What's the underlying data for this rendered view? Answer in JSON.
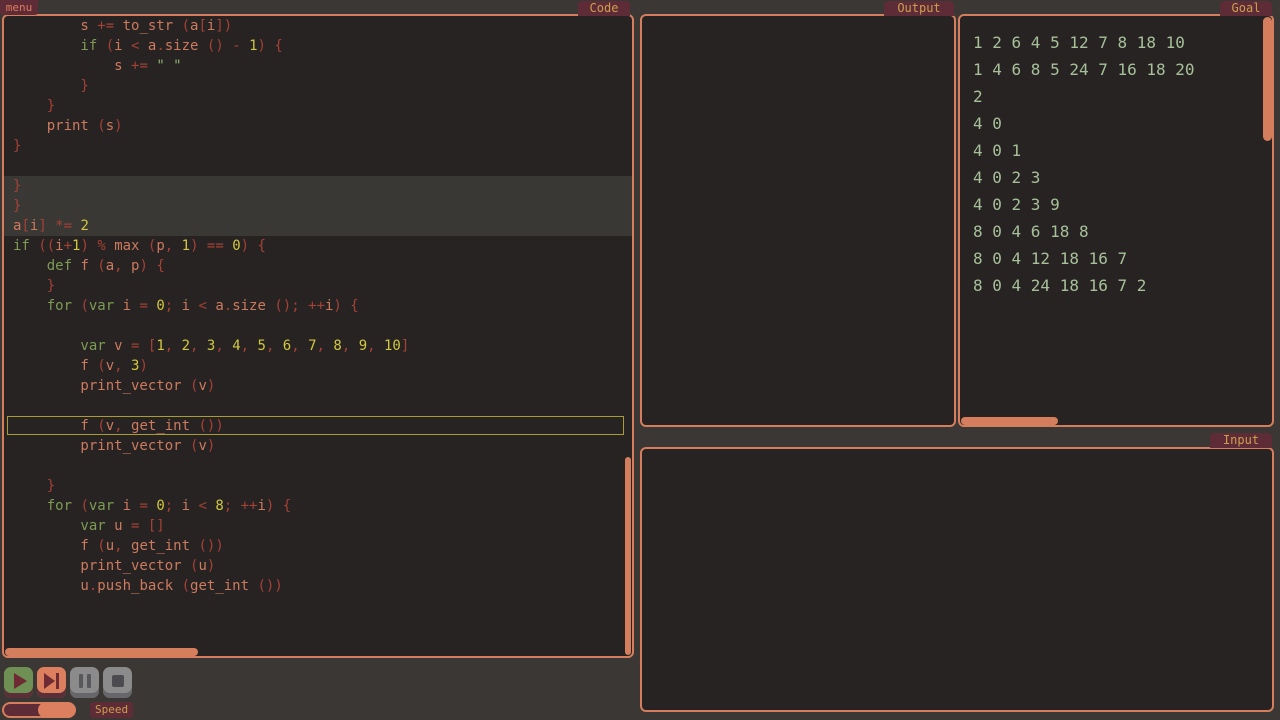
{
  "menu": {
    "label": "menu"
  },
  "tabs": {
    "code": "Code",
    "output": "Output",
    "goal": "Goal",
    "input": "Input"
  },
  "code": {
    "lines": [
      {
        "tk": [
          [
            "t",
            "        s "
          ],
          [
            "o",
            "+= "
          ],
          [
            "t",
            "to_str "
          ],
          [
            "o",
            "("
          ],
          [
            "t",
            "a"
          ],
          [
            "o",
            "["
          ],
          [
            "t",
            "i"
          ],
          [
            "o",
            "])"
          ]
        ]
      },
      {
        "tk": [
          [
            "k",
            "        if "
          ],
          [
            "o",
            "("
          ],
          [
            "t",
            "i "
          ],
          [
            "o",
            "< "
          ],
          [
            "t",
            "a"
          ],
          [
            "o",
            "."
          ],
          [
            "t",
            "size "
          ],
          [
            "o",
            "() - "
          ],
          [
            "n",
            "1"
          ],
          [
            "o",
            ") {"
          ]
        ]
      },
      {
        "tk": [
          [
            "t",
            "            s "
          ],
          [
            "o",
            "+= "
          ],
          [
            "s",
            "\" \""
          ]
        ]
      },
      {
        "tk": [
          [
            "o",
            "        }"
          ]
        ]
      },
      {
        "tk": [
          [
            "o",
            "    }"
          ]
        ]
      },
      {
        "tk": [
          [
            "t",
            "    print "
          ],
          [
            "o",
            "("
          ],
          [
            "t",
            "s"
          ],
          [
            "o",
            ")"
          ]
        ]
      },
      {
        "tk": [
          [
            "o",
            "}"
          ]
        ]
      },
      {
        "tk": []
      },
      {
        "hl": true,
        "tk": [
          [
            "o",
            "}"
          ]
        ]
      },
      {
        "hl": true,
        "tk": [
          [
            "o",
            "}"
          ]
        ]
      },
      {
        "hl": true,
        "tk": [
          [
            "t",
            "a"
          ],
          [
            "o",
            "["
          ],
          [
            "t",
            "i"
          ],
          [
            "o",
            "] *= "
          ],
          [
            "n",
            "2"
          ]
        ]
      },
      {
        "tk": [
          [
            "k",
            "if "
          ],
          [
            "o",
            "(("
          ],
          [
            "t",
            "i"
          ],
          [
            "o",
            "+"
          ],
          [
            "n",
            "1"
          ],
          [
            "o",
            ") % "
          ],
          [
            "t",
            "max "
          ],
          [
            "o",
            "("
          ],
          [
            "t",
            "p"
          ],
          [
            "o",
            ", "
          ],
          [
            "n",
            "1"
          ],
          [
            "o",
            ") == "
          ],
          [
            "n",
            "0"
          ],
          [
            "o",
            ") {"
          ]
        ]
      },
      {
        "tk": [
          [
            "k",
            "    def "
          ],
          [
            "t",
            "f "
          ],
          [
            "o",
            "("
          ],
          [
            "t",
            "a"
          ],
          [
            "o",
            ", "
          ],
          [
            "t",
            "p"
          ],
          [
            "o",
            ") {"
          ]
        ]
      },
      {
        "tk": [
          [
            "o",
            "    }"
          ]
        ]
      },
      {
        "tk": [
          [
            "k",
            "    for "
          ],
          [
            "o",
            "("
          ],
          [
            "k",
            "var "
          ],
          [
            "t",
            "i "
          ],
          [
            "o",
            "= "
          ],
          [
            "n",
            "0"
          ],
          [
            "o",
            "; "
          ],
          [
            "t",
            "i "
          ],
          [
            "o",
            "< "
          ],
          [
            "t",
            "a"
          ],
          [
            "o",
            "."
          ],
          [
            "t",
            "size "
          ],
          [
            "o",
            "(); ++"
          ],
          [
            "t",
            "i"
          ],
          [
            "o",
            ") {"
          ]
        ]
      },
      {
        "tk": []
      },
      {
        "tk": [
          [
            "k",
            "        var "
          ],
          [
            "t",
            "v "
          ],
          [
            "o",
            "= ["
          ],
          [
            "n",
            "1"
          ],
          [
            "o",
            ", "
          ],
          [
            "n",
            "2"
          ],
          [
            "o",
            ", "
          ],
          [
            "n",
            "3"
          ],
          [
            "o",
            ", "
          ],
          [
            "n",
            "4"
          ],
          [
            "o",
            ", "
          ],
          [
            "n",
            "5"
          ],
          [
            "o",
            ", "
          ],
          [
            "n",
            "6"
          ],
          [
            "o",
            ", "
          ],
          [
            "n",
            "7"
          ],
          [
            "o",
            ", "
          ],
          [
            "n",
            "8"
          ],
          [
            "o",
            ", "
          ],
          [
            "n",
            "9"
          ],
          [
            "o",
            ", "
          ],
          [
            "n",
            "10"
          ],
          [
            "o",
            "]"
          ]
        ]
      },
      {
        "tk": [
          [
            "t",
            "        f "
          ],
          [
            "o",
            "("
          ],
          [
            "t",
            "v"
          ],
          [
            "o",
            ", "
          ],
          [
            "n",
            "3"
          ],
          [
            "o",
            ")"
          ]
        ]
      },
      {
        "tk": [
          [
            "t",
            "        print_vector "
          ],
          [
            "o",
            "("
          ],
          [
            "t",
            "v"
          ],
          [
            "o",
            ")"
          ]
        ]
      },
      {
        "tk": []
      },
      {
        "box": true,
        "tk": [
          [
            "t",
            "        f "
          ],
          [
            "o",
            "("
          ],
          [
            "t",
            "v"
          ],
          [
            "o",
            ", "
          ],
          [
            "t",
            "get_int "
          ],
          [
            "o",
            "())"
          ]
        ]
      },
      {
        "tk": [
          [
            "t",
            "        print_vector "
          ],
          [
            "o",
            "("
          ],
          [
            "t",
            "v"
          ],
          [
            "o",
            ")"
          ]
        ]
      },
      {
        "tk": []
      },
      {
        "tk": [
          [
            "o",
            "    }"
          ]
        ]
      },
      {
        "tk": [
          [
            "k",
            "    for "
          ],
          [
            "o",
            "("
          ],
          [
            "k",
            "var "
          ],
          [
            "t",
            "i "
          ],
          [
            "o",
            "= "
          ],
          [
            "n",
            "0"
          ],
          [
            "o",
            "; "
          ],
          [
            "t",
            "i "
          ],
          [
            "o",
            "< "
          ],
          [
            "n",
            "8"
          ],
          [
            "o",
            "; ++"
          ],
          [
            "t",
            "i"
          ],
          [
            "o",
            ") {"
          ]
        ]
      },
      {
        "tk": [
          [
            "k",
            "        var "
          ],
          [
            "t",
            "u "
          ],
          [
            "o",
            "= []"
          ]
        ]
      },
      {
        "tk": [
          [
            "t",
            "        f "
          ],
          [
            "o",
            "("
          ],
          [
            "t",
            "u"
          ],
          [
            "o",
            ", "
          ],
          [
            "t",
            "get_int "
          ],
          [
            "o",
            "())"
          ]
        ]
      },
      {
        "tk": [
          [
            "t",
            "        print_vector "
          ],
          [
            "o",
            "("
          ],
          [
            "t",
            "u"
          ],
          [
            "o",
            ")"
          ]
        ]
      },
      {
        "tk": [
          [
            "t",
            "        u"
          ],
          [
            "o",
            "."
          ],
          [
            "t",
            "push_back "
          ],
          [
            "o",
            "("
          ],
          [
            "t",
            "get_int "
          ],
          [
            "o",
            "())"
          ]
        ]
      }
    ]
  },
  "output": {
    "lines": []
  },
  "goal": {
    "lines": [
      "1 2 6 4 5 12 7 8 18 10",
      "1 4 6 8 5 24 7 16 18 20",
      "2",
      "4 0",
      "4 0 1",
      "4 0 2 3",
      "4 0 2 3 9",
      "8 0 4 6 18 8",
      "8 0 4 12 18 16 7",
      "8 0 4 24 18 16 7 2"
    ]
  },
  "input": {
    "lines": []
  },
  "speed": {
    "label": "Speed"
  },
  "colors": {
    "page_bg": "#3a3734",
    "panel_bg": "#262322",
    "border": "#d57e5d",
    "thumb": "#d57e5d",
    "tab_bg": "#5e2c37",
    "tab_text": "#cf9e4d",
    "menu_text": "#e07b5c",
    "code_id": "#cd7a5f",
    "code_kw": "#7e9b55",
    "code_op": "#a64136",
    "code_num": "#d2c73e",
    "code_str": "#8fae71",
    "hl_bg": "#3a3835",
    "box_border": "#a99b38",
    "goal_text": "#a7c099",
    "btn_play": "#6e9054",
    "btn_step": "#dc7f5e",
    "btn_gray": "#8b8b8b",
    "lip_maroon": "#5b2f38",
    "lip_gray": "#67666a",
    "glyph_maroon": "#6f2b34",
    "glyph_gray": "#58575b",
    "glyph_stop": "#4c4b4f"
  }
}
